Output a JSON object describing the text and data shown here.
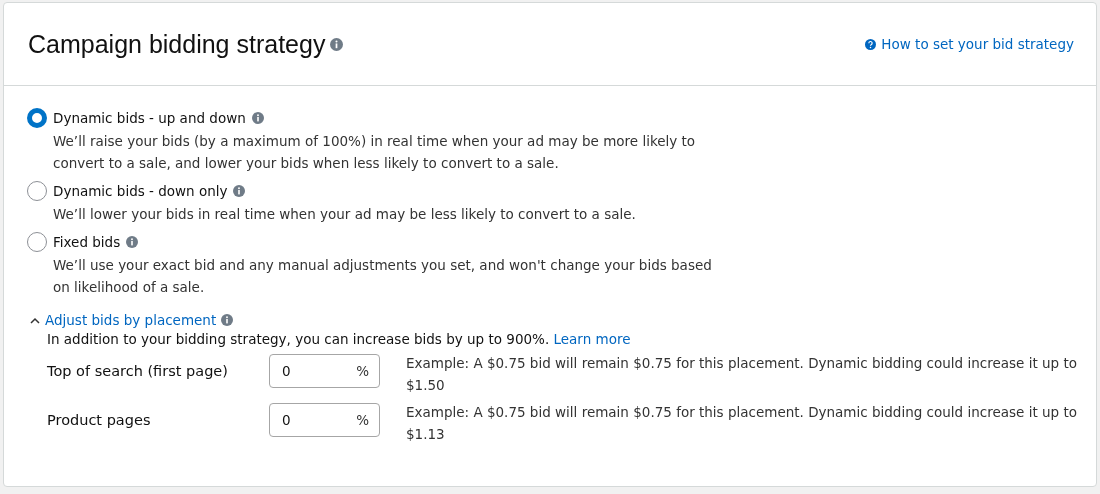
{
  "header": {
    "title": "Campaign bidding strategy",
    "help_link": "How to set your bid strategy"
  },
  "strategies": [
    {
      "label": "Dynamic bids - up and down",
      "description": "We’ll raise your bids (by a maximum of 100%) in real time when your ad may be more likely to convert to a sale, and lower your bids when less likely to convert to a sale.",
      "selected": true
    },
    {
      "label": "Dynamic bids - down only",
      "description": "We’ll lower your bids in real time when your ad may be less likely to convert to a sale.",
      "selected": false
    },
    {
      "label": "Fixed bids",
      "description": "We’ll use your exact bid and any manual adjustments you set, and won't change your bids based on likelihood of a sale.",
      "selected": false
    }
  ],
  "placement": {
    "title": "Adjust bids by placement",
    "expanded": true,
    "intro": "In addition to your bidding strategy, you can increase bids by up to 900%.",
    "learn_more": "Learn more",
    "rows": [
      {
        "label": "Top of search (first page)",
        "value": "0",
        "unit": "%",
        "example": "Example: A $0.75 bid will remain $0.75 for this placement. Dynamic bidding could increase it up to $1.50"
      },
      {
        "label": "Product pages",
        "value": "0",
        "unit": "%",
        "example": "Example: A $0.75 bid will remain $0.75 for this placement. Dynamic bidding could increase it up to $1.13"
      }
    ]
  }
}
